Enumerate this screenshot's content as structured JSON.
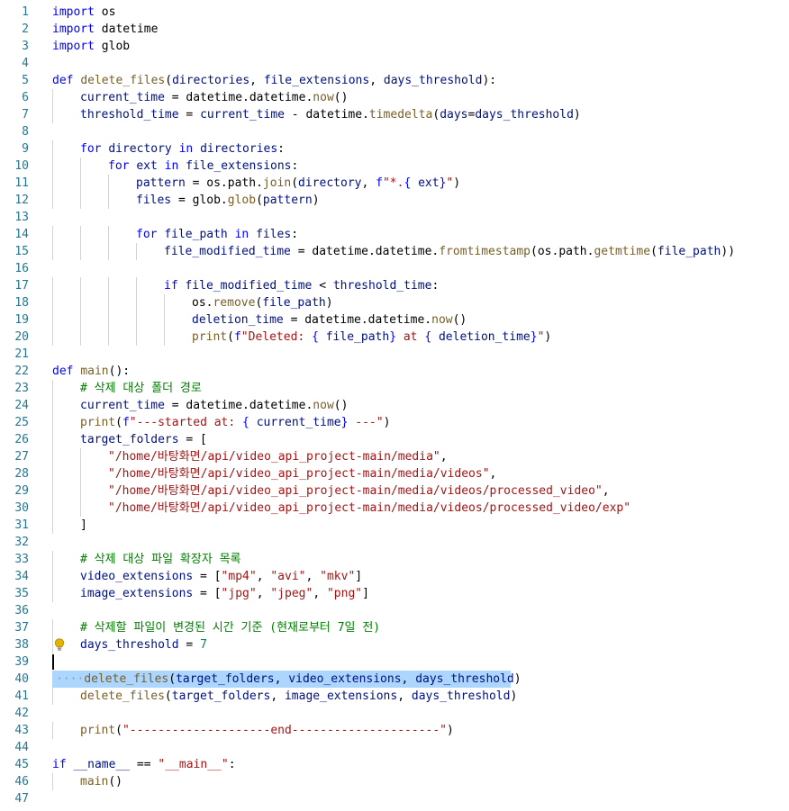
{
  "editor": {
    "line_numbers": [
      "1",
      "2",
      "3",
      "4",
      "5",
      "6",
      "7",
      "8",
      "9",
      "10",
      "11",
      "12",
      "13",
      "14",
      "15",
      "16",
      "17",
      "18",
      "19",
      "20",
      "21",
      "22",
      "23",
      "24",
      "25",
      "26",
      "27",
      "28",
      "29",
      "30",
      "31",
      "32",
      "33",
      "34",
      "35",
      "36",
      "37",
      "38",
      "39",
      "40",
      "41",
      "42",
      "43",
      "44",
      "45",
      "46",
      "47"
    ],
    "lines": [
      [
        [
          "k",
          "import"
        ],
        [
          "",
          "os"
        ]
      ],
      [
        [
          "k",
          "import"
        ],
        [
          "",
          "datetime"
        ]
      ],
      [
        [
          "k",
          "import"
        ],
        [
          "",
          "glob"
        ]
      ],
      [],
      [
        [
          "k",
          "def"
        ],
        [
          "c",
          "delete_files"
        ],
        [
          "",
          "("
        ],
        [
          "v",
          "directories"
        ],
        [
          "",
          ", "
        ],
        [
          "v",
          "file_extensions"
        ],
        [
          "",
          ", "
        ],
        [
          "v",
          "days_threshold"
        ],
        [
          "",
          "):"
        ]
      ],
      [
        [
          "v",
          "current_time"
        ],
        [
          "",
          " = datetime.datetime."
        ],
        [
          "c",
          "now"
        ],
        [
          "",
          "()"
        ]
      ],
      [
        [
          "v",
          "threshold_time"
        ],
        [
          "",
          " = "
        ],
        [
          "v",
          "current_time"
        ],
        [
          "",
          " - datetime."
        ],
        [
          "c",
          "timedelta"
        ],
        [
          "",
          "("
        ],
        [
          "v",
          "days"
        ],
        [
          "",
          "="
        ],
        [
          "v",
          "days_threshold"
        ],
        [
          "",
          ")"
        ]
      ],
      [],
      [
        [
          "k",
          "for"
        ],
        [
          "",
          " "
        ],
        [
          "v",
          "directory"
        ],
        [
          "",
          " "
        ],
        [
          "k",
          "in"
        ],
        [
          "",
          " "
        ],
        [
          "v",
          "directories"
        ],
        [
          "",
          ":"
        ]
      ],
      [
        [
          "k",
          "for"
        ],
        [
          "",
          " "
        ],
        [
          "v",
          "ext"
        ],
        [
          "",
          " "
        ],
        [
          "k",
          "in"
        ],
        [
          "",
          " "
        ],
        [
          "v",
          "file_extensions"
        ],
        [
          "",
          ":"
        ]
      ],
      [
        [
          "v",
          "pattern"
        ],
        [
          "",
          " = os.path."
        ],
        [
          "c",
          "join"
        ],
        [
          "",
          "("
        ],
        [
          "v",
          "directory"
        ],
        [
          "",
          ", "
        ],
        [
          "k",
          "f"
        ],
        [
          "s",
          "\"*."
        ],
        [
          "k",
          "{"
        ],
        [
          "v",
          "ext"
        ],
        [
          "k",
          "}"
        ],
        [
          "s",
          "\""
        ],
        [
          "",
          ")"
        ]
      ],
      [
        [
          "v",
          "files"
        ],
        [
          "",
          " = glob."
        ],
        [
          "c",
          "glob"
        ],
        [
          "",
          "("
        ],
        [
          "v",
          "pattern"
        ],
        [
          "",
          ")"
        ]
      ],
      [],
      [
        [
          "k",
          "for"
        ],
        [
          "",
          " "
        ],
        [
          "v",
          "file_path"
        ],
        [
          "",
          " "
        ],
        [
          "k",
          "in"
        ],
        [
          "",
          " "
        ],
        [
          "v",
          "files"
        ],
        [
          "",
          ":"
        ]
      ],
      [
        [
          "v",
          "file_modified_time"
        ],
        [
          "",
          " = datetime.datetime."
        ],
        [
          "c",
          "fromtimestamp"
        ],
        [
          "",
          "(os.path."
        ],
        [
          "c",
          "getmtime"
        ],
        [
          "",
          "("
        ],
        [
          "v",
          "file_path"
        ],
        [
          "",
          "))"
        ]
      ],
      [],
      [
        [
          "k",
          "if"
        ],
        [
          "",
          " "
        ],
        [
          "v",
          "file_modified_time"
        ],
        [
          "",
          " < "
        ],
        [
          "v",
          "threshold_time"
        ],
        [
          "",
          ":"
        ]
      ],
      [
        [
          "",
          "os."
        ],
        [
          "c",
          "remove"
        ],
        [
          "",
          "("
        ],
        [
          "v",
          "file_path"
        ],
        [
          "",
          ")"
        ]
      ],
      [
        [
          "v",
          "deletion_time"
        ],
        [
          "",
          " = datetime.datetime."
        ],
        [
          "c",
          "now"
        ],
        [
          "",
          "()"
        ]
      ],
      [
        [
          "c",
          "print"
        ],
        [
          "",
          "("
        ],
        [
          "k",
          "f"
        ],
        [
          "s",
          "\"Deleted: "
        ],
        [
          "k",
          "{"
        ],
        [
          "v",
          "file_path"
        ],
        [
          "k",
          "}"
        ],
        [
          "s",
          " at "
        ],
        [
          "k",
          "{"
        ],
        [
          "v",
          "deletion_time"
        ],
        [
          "k",
          "}"
        ],
        [
          "s",
          "\""
        ],
        [
          "",
          ")"
        ]
      ],
      [],
      [
        [
          "k",
          "def"
        ],
        [
          "c",
          "main"
        ],
        [
          "",
          "():"
        ]
      ],
      [
        [
          "cm",
          "# 삭제 대상 폴더 경로"
        ]
      ],
      [
        [
          "v",
          "current_time"
        ],
        [
          "",
          " = datetime.datetime."
        ],
        [
          "c",
          "now"
        ],
        [
          "",
          "()"
        ]
      ],
      [
        [
          "c",
          "print"
        ],
        [
          "",
          "("
        ],
        [
          "k",
          "f"
        ],
        [
          "s",
          "\"---started at: "
        ],
        [
          "k",
          "{"
        ],
        [
          "v",
          "current_time"
        ],
        [
          "k",
          "}"
        ],
        [
          "s",
          "---\""
        ],
        [
          "",
          ")"
        ]
      ],
      [
        [
          "v",
          "target_folders"
        ],
        [
          "",
          " = ["
        ]
      ],
      [
        [
          "s",
          "\"/home/바탕화면/api/video_api_project-main/media\""
        ],
        [
          "",
          ","
        ]
      ],
      [
        [
          "s",
          "\"/home/바탕화면/api/video_api_project-main/media/videos\""
        ],
        [
          "",
          ","
        ]
      ],
      [
        [
          "s",
          "\"/home/바탕화면/api/video_api_project-main/media/videos/processed_video\""
        ],
        [
          "",
          ","
        ]
      ],
      [
        [
          "s",
          "\"/home/바탕화면/api/video_api_project-main/media/videos/processed_video/exp\""
        ]
      ],
      [
        [
          "",
          "]"
        ]
      ],
      [],
      [
        [
          "cm",
          "# 삭제 대상 파일 확장자 목록"
        ]
      ],
      [
        [
          "v",
          "video_extensions"
        ],
        [
          "",
          " = ["
        ],
        [
          "s",
          "\"mp4\""
        ],
        [
          "",
          ", "
        ],
        [
          "s",
          "\"avi\""
        ],
        [
          "",
          ", "
        ],
        [
          "s",
          "\"mkv\""
        ],
        [
          "",
          "]"
        ]
      ],
      [
        [
          "v",
          "image_extensions"
        ],
        [
          "",
          " = ["
        ],
        [
          "s",
          "\"jpg\""
        ],
        [
          "",
          ", "
        ],
        [
          "s",
          "\"jpeg\""
        ],
        [
          "",
          ", "
        ],
        [
          "s",
          "\"png\""
        ],
        [
          "",
          "]"
        ]
      ],
      [],
      [
        [
          "cm",
          "# 삭제할 파일이 변경된 시간 기준 (현재로부터 7일 전)"
        ]
      ],
      [
        [
          "v",
          "days_threshold"
        ],
        [
          "",
          " = "
        ],
        [
          "n",
          "7"
        ]
      ],
      [],
      [
        [
          "dots",
          "····"
        ],
        [
          "c",
          "delete_files"
        ],
        [
          "",
          "("
        ],
        [
          "v",
          "target_folders"
        ],
        [
          "",
          ", "
        ],
        [
          "v",
          "video_extensions"
        ],
        [
          "",
          ", "
        ],
        [
          "v",
          "days_threshold"
        ],
        [
          "",
          ")"
        ]
      ],
      [
        [
          "c",
          "delete_files"
        ],
        [
          "",
          "("
        ],
        [
          "v",
          "target_folders"
        ],
        [
          "",
          ", "
        ],
        [
          "v",
          "image_extensions"
        ],
        [
          "",
          ", "
        ],
        [
          "v",
          "days_threshold"
        ],
        [
          "",
          ")"
        ]
      ],
      [],
      [
        [
          "c",
          "print"
        ],
        [
          "",
          "("
        ],
        [
          "s",
          "\"--------------------end---------------------\""
        ],
        [
          "",
          ")"
        ]
      ],
      [],
      [
        [
          "k",
          "if"
        ],
        [
          "",
          " "
        ],
        [
          "v",
          "__name__"
        ],
        [
          "",
          " == "
        ],
        [
          "s",
          "\"__main__\""
        ],
        [
          "",
          ":"
        ]
      ],
      [
        [
          "c",
          "main"
        ],
        [
          "",
          "()"
        ]
      ],
      []
    ],
    "indents": [
      0,
      0,
      0,
      0,
      0,
      1,
      1,
      0,
      1,
      2,
      3,
      3,
      0,
      3,
      4,
      0,
      4,
      5,
      5,
      5,
      0,
      0,
      1,
      1,
      1,
      1,
      2,
      2,
      2,
      2,
      1,
      0,
      1,
      1,
      1,
      0,
      1,
      1,
      0,
      0,
      1,
      0,
      1,
      0,
      0,
      1,
      0
    ],
    "highlighted_line": 40,
    "cursor_line": 39,
    "lightbulb_line": 38,
    "colors": {
      "keyword": "#0000ff",
      "function": "#795e26",
      "variable": "#001080",
      "string": "#a31515",
      "number": "#098658",
      "comment": "#008000",
      "line_number": "#237893",
      "selection": "#add6ff"
    }
  }
}
